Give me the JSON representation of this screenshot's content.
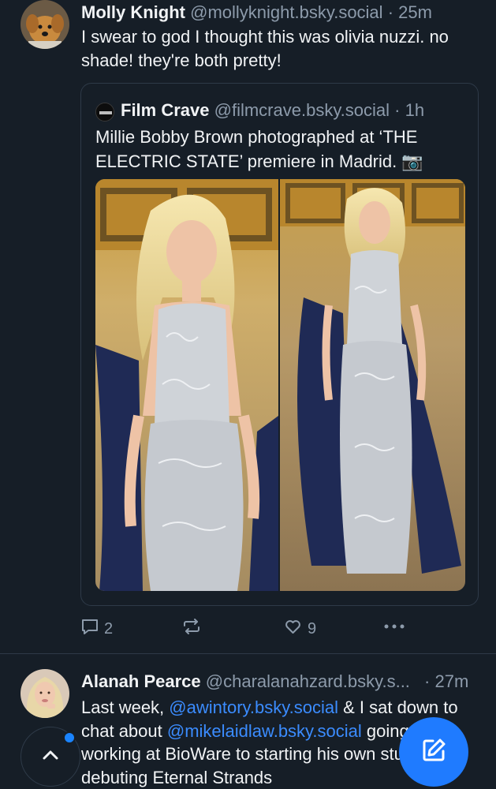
{
  "posts": [
    {
      "author": "Molly Knight",
      "handle": "@mollyknight.bsky.social",
      "time": "· 25m",
      "text": "I swear to god I thought this was olivia nuzzi. no shade! they're both pretty!",
      "quote": {
        "author": "Film Crave",
        "handle": "@filmcrave.bsky.social",
        "time": "· 1h",
        "text": "Millie Bobby Brown photographed at ‘THE ELECTRIC STATE’ premiere in Madrid. 📷"
      },
      "actions": {
        "replies": "2",
        "likes": "9"
      }
    },
    {
      "author": "Alanah Pearce",
      "handle": "@charalanahzard.bsky.s...",
      "time": "· 27m",
      "text_parts": {
        "p1": "Last week, ",
        "m1": "@awintory.bsky.social",
        "p2": " & I sat down to chat about ",
        "m2": "@mikelaidlaw.bsky.social",
        "p3": " going from working at BioWare to starting his own studio, and debuting Eternal Strands"
      }
    }
  ],
  "colors": {
    "background": "#161e27",
    "accent": "#1f7bff",
    "mention": "#3b8cff",
    "muted": "#8d9bab"
  },
  "icons": [
    "reply-icon",
    "repost-icon",
    "like-icon",
    "more-icon",
    "chevron-up-icon",
    "compose-icon"
  ]
}
